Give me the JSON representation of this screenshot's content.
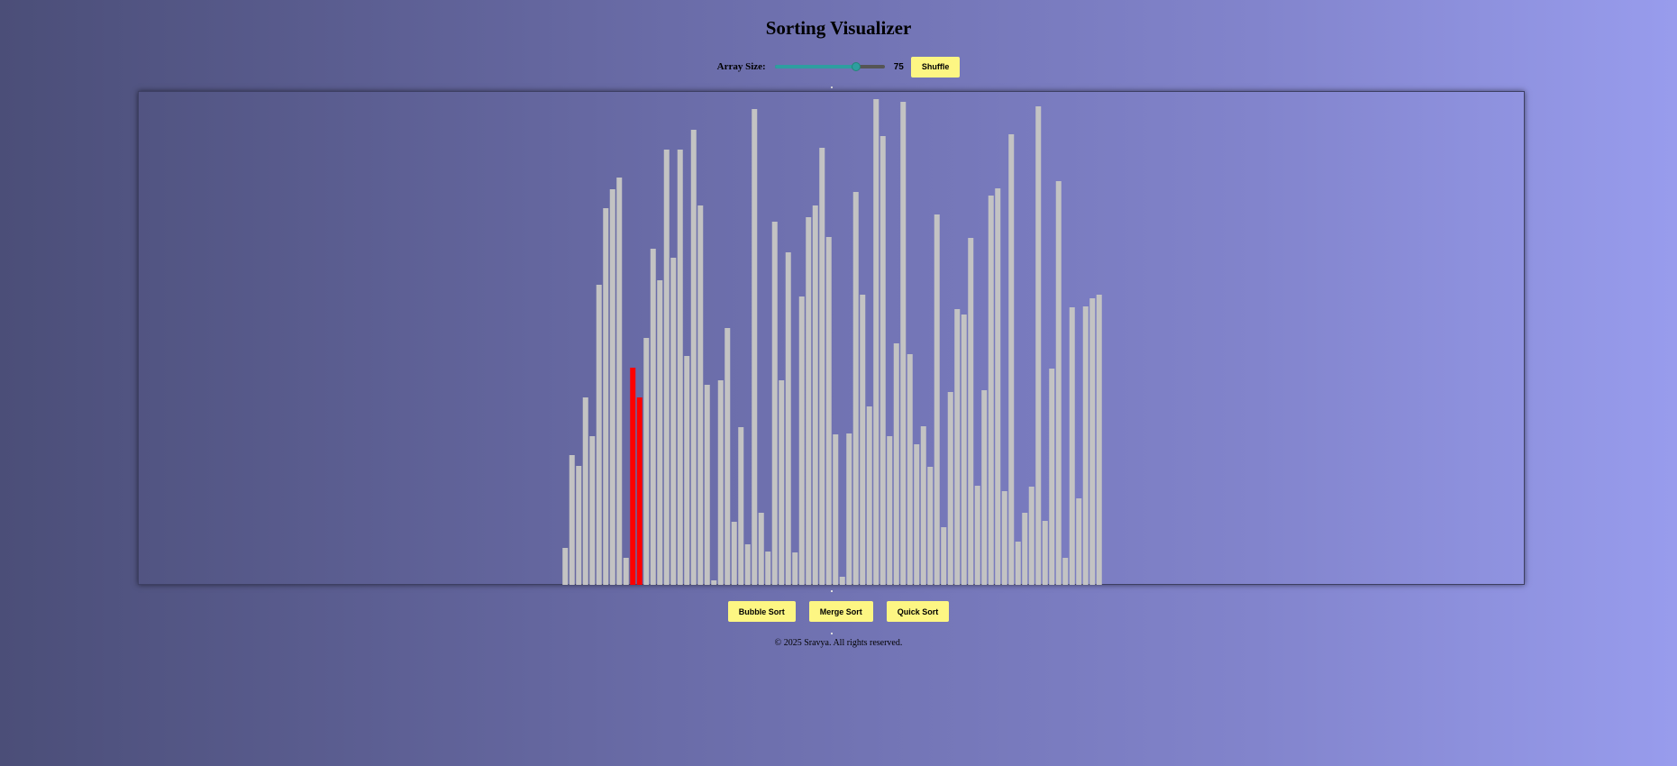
{
  "page": {
    "title": "Sorting Visualizer",
    "footer": "© 2025 Sravya. All rights reserved."
  },
  "controls": {
    "array_size_label": "Array Size:",
    "array_size_value": "75",
    "slider_min": 5,
    "slider_max": 100,
    "slider_value": 75,
    "shuffle_label": "Shuffle"
  },
  "sort_buttons": {
    "bubble_label": "Bubble Sort",
    "merge_label": "Merge Sort",
    "quick_label": "Quick Sort"
  },
  "colors": {
    "bar": "#c3c3c3",
    "bar_active": "#ff0000",
    "button": "#fdf683",
    "slider_accent": "#2e9ea0"
  },
  "chart_data": {
    "type": "bar",
    "title": "",
    "xlabel": "",
    "ylabel": "",
    "ylim": [
      0,
      540
    ],
    "values": [
      41,
      144,
      132,
      208,
      165,
      333,
      418,
      439,
      452,
      30,
      241,
      208,
      274,
      373,
      338,
      483,
      363,
      483,
      254,
      505,
      421,
      222,
      5,
      227,
      285,
      70,
      175,
      45,
      528,
      80,
      37,
      403,
      227,
      369,
      36,
      320,
      408,
      421,
      485,
      386,
      167,
      9,
      168,
      436,
      322,
      198,
      539,
      498,
      165,
      268,
      536,
      256,
      156,
      176,
      131,
      411,
      64,
      214,
      306,
      300,
      385,
      110,
      216,
      432,
      440,
      104,
      500,
      48,
      80,
      109,
      531,
      71,
      240,
      448,
      30,
      308,
      96,
      309,
      318,
      322
    ],
    "highlighted_indices": [
      10,
      11
    ]
  }
}
